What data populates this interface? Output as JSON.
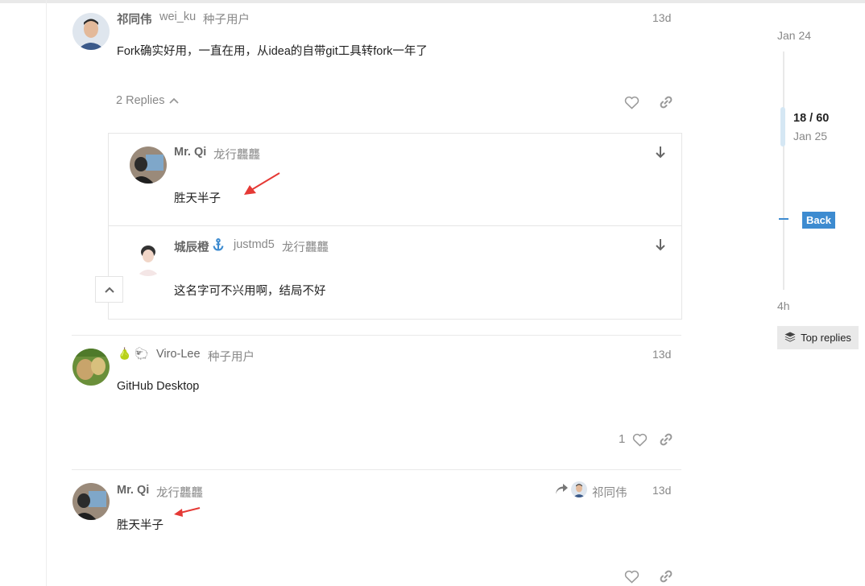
{
  "posts": [
    {
      "author": "祁同伟",
      "username": "wei_ku",
      "group": "种子用户",
      "date": "13d",
      "body": "Fork确实好用，一直在用，从idea的自带git工具转fork一年了",
      "replies_label": "2 Replies"
    },
    {
      "emojis": "🍐 🐑",
      "username": "Viro-Lee",
      "group": "种子用户",
      "date": "13d",
      "body": "GitHub Desktop",
      "like_count": "1"
    },
    {
      "author": "Mr. Qi",
      "group": "龙行龘龘",
      "reply_to": "祁同伟",
      "date": "13d",
      "body": "胜天半子"
    }
  ],
  "embedded_replies": [
    {
      "author": "Mr. Qi",
      "group": "龙行龘龘",
      "body": "胜天半子"
    },
    {
      "author": "城辰橙",
      "username": "justmd5",
      "group": "龙行龘龘",
      "body": "这名字可不兴用啊，结局不好"
    }
  ],
  "timeline": {
    "start_date": "Jan 24",
    "position": "18 / 60",
    "position_date": "Jan 25",
    "back_label": "Back",
    "end_label": "4h",
    "top_replies_label": "Top replies"
  },
  "colors": {
    "accent": "#3d8bd0",
    "annotation_arrow": "#e53935",
    "muted_text": "#888888"
  }
}
